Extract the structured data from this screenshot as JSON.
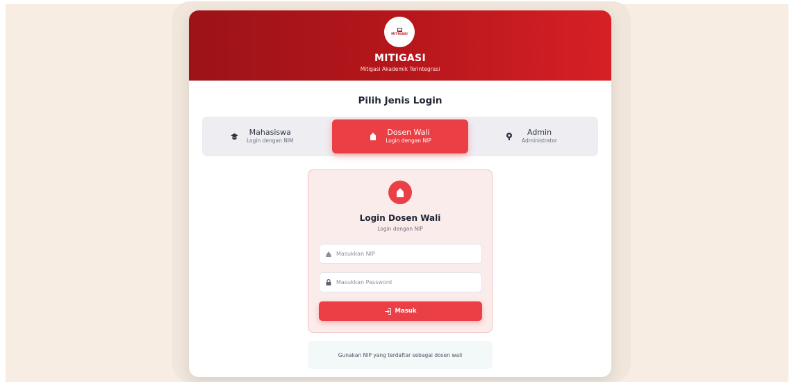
{
  "header": {
    "logo_text": "MITIGASI",
    "title": "MITIGASI",
    "subtitle": "Mitigasi Akademik Terintegrasi"
  },
  "login_type": {
    "title": "Pilih Jenis Login",
    "tabs": [
      {
        "label": "Mahasiswa",
        "sub": "Login dengan NIM",
        "icon": "graduation-cap-icon",
        "active": false
      },
      {
        "label": "Dosen Wali",
        "sub": "Login dengan NIP",
        "icon": "lecturer-icon",
        "active": true
      },
      {
        "label": "Admin",
        "sub": "Administrator",
        "icon": "admin-icon",
        "active": false
      }
    ]
  },
  "form": {
    "title": "Login Dosen Wali",
    "subtitle": "Login dengan NIP",
    "nip_placeholder": "Masukkan NIP",
    "nip_value": "",
    "password_placeholder": "Masukkan Password",
    "password_value": "",
    "submit_label": "Masuk"
  },
  "info": {
    "text": "Gunakan NIP yang terdaftar sebagai dosen wali"
  },
  "colors": {
    "primary": "#ea4045",
    "header_dark": "#9c1318",
    "header_light": "#d62026",
    "page_bg": "#f8ede3"
  }
}
